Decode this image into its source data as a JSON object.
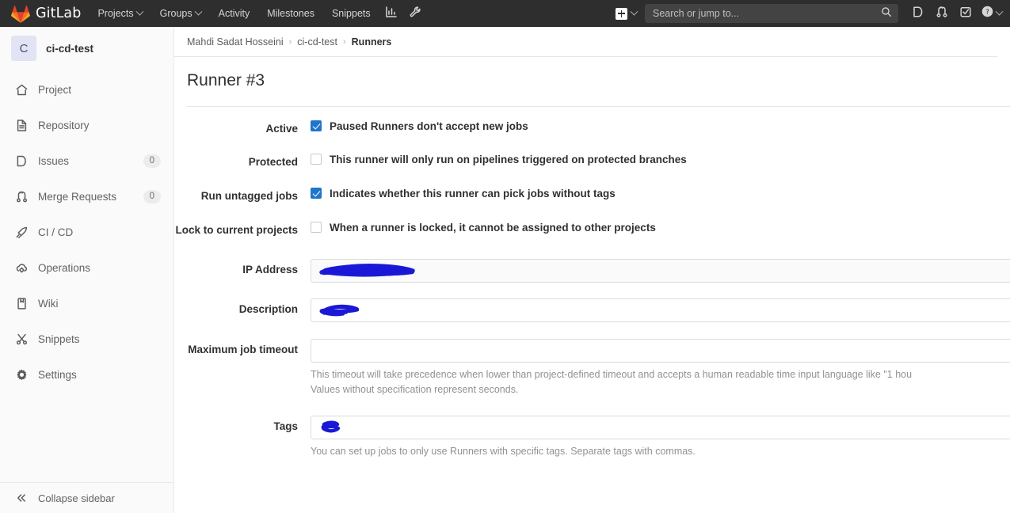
{
  "topnav": {
    "brand": "GitLab",
    "brand_icon": "gitlab-fox-logo",
    "links": [
      {
        "label": "Projects",
        "icon": "chevron-down-icon",
        "has_caret": true
      },
      {
        "label": "Groups",
        "icon": "chevron-down-icon",
        "has_caret": true
      },
      {
        "label": "Activity",
        "has_caret": false
      },
      {
        "label": "Milestones",
        "has_caret": false
      },
      {
        "label": "Snippets",
        "has_caret": false
      }
    ],
    "analytics_icon": "chart-bar-icon",
    "admin_icon": "wrench-icon",
    "create_new_icon": "plus-square-icon",
    "create_new_caret": "chevron-down-icon",
    "search": {
      "placeholder": "Search or jump to...",
      "icon": "search-icon"
    },
    "right_icons": [
      {
        "name": "issues-icon"
      },
      {
        "name": "merge-requests-icon"
      },
      {
        "name": "todos-icon"
      }
    ],
    "help": {
      "icon": "help-circle-icon",
      "caret": "chevron-down-icon"
    },
    "background_color": "#2e2e2e",
    "search_background": "#434343"
  },
  "sidebar": {
    "project": {
      "avatar_letter": "C",
      "name": "ci-cd-test"
    },
    "items": [
      {
        "label": "Project",
        "icon": "home-icon",
        "badge": ""
      },
      {
        "label": "Repository",
        "icon": "document-icon",
        "badge": ""
      },
      {
        "label": "Issues",
        "icon": "issues-icon",
        "badge": "0"
      },
      {
        "label": "Merge Requests",
        "icon": "merge-requests-icon",
        "badge": "0"
      },
      {
        "label": "CI / CD",
        "icon": "rocket-icon",
        "badge": ""
      },
      {
        "label": "Operations",
        "icon": "cloud-gear-icon",
        "badge": ""
      },
      {
        "label": "Wiki",
        "icon": "book-icon",
        "badge": ""
      },
      {
        "label": "Snippets",
        "icon": "scissors-icon",
        "badge": ""
      },
      {
        "label": "Settings",
        "icon": "gear-icon",
        "badge": ""
      }
    ],
    "collapse": {
      "label": "Collapse sidebar",
      "icon": "double-chevron-left-icon"
    }
  },
  "breadcrumb": {
    "items": [
      "Mahdi Sadat Hosseini",
      "ci-cd-test",
      "Runners"
    ],
    "separator": "›"
  },
  "page": {
    "title": "Runner #3"
  },
  "form": {
    "active": {
      "label": "Active",
      "description": "Paused Runners don't accept new jobs",
      "checked": true
    },
    "protected": {
      "label": "Protected",
      "description": "This runner will only run on pipelines triggered on protected branches",
      "checked": false
    },
    "run_untagged": {
      "label": "Run untagged jobs",
      "description": "Indicates whether this runner can pick jobs without tags",
      "checked": true
    },
    "locked": {
      "label": "Lock to current projects",
      "description": "When a runner is locked, it cannot be assigned to other projects",
      "checked": false
    },
    "ip_address": {
      "label": "IP Address",
      "value": "",
      "redacted": true,
      "readonly": true
    },
    "description": {
      "label": "Description",
      "value": "",
      "redacted": true,
      "readonly": false
    },
    "max_timeout": {
      "label": "Maximum job timeout",
      "value": "",
      "help_line_1": "This timeout will take precedence when lower than project-defined timeout and accepts a human readable time input language like \"1 hou",
      "help_line_2": "Values without specification represent seconds."
    },
    "tags": {
      "label": "Tags",
      "value": "",
      "redacted": true,
      "help": "You can set up jobs to only use Runners with specific tags. Separate tags with commas."
    },
    "redaction_color": "#1a18d6"
  }
}
